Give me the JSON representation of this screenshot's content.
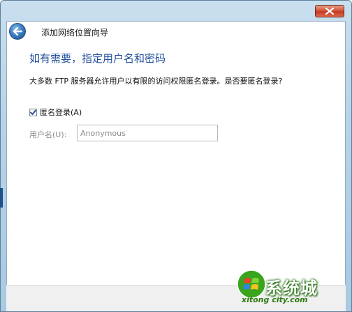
{
  "window": {
    "close_icon": "close-icon",
    "colors": {
      "frame": "#b7d3e8",
      "close_button": "#c23a22",
      "heading": "#1e4c9a"
    }
  },
  "header": {
    "back_icon": "arrow-left-icon",
    "title": "添加网络位置向导"
  },
  "main": {
    "heading": "如有需要，指定用户名和密码",
    "description": "大多数 FTP 服务器允许用户以有限的访问权限匿名登录。是否要匿名登录?",
    "anonymous_checkbox": {
      "label": "匿名登录(A)",
      "checked": true
    },
    "username": {
      "label": "用户名(U):",
      "value": "Anonymous",
      "disabled": true
    }
  },
  "watermark": {
    "brand": "系统城",
    "url": "xitong city.com"
  }
}
